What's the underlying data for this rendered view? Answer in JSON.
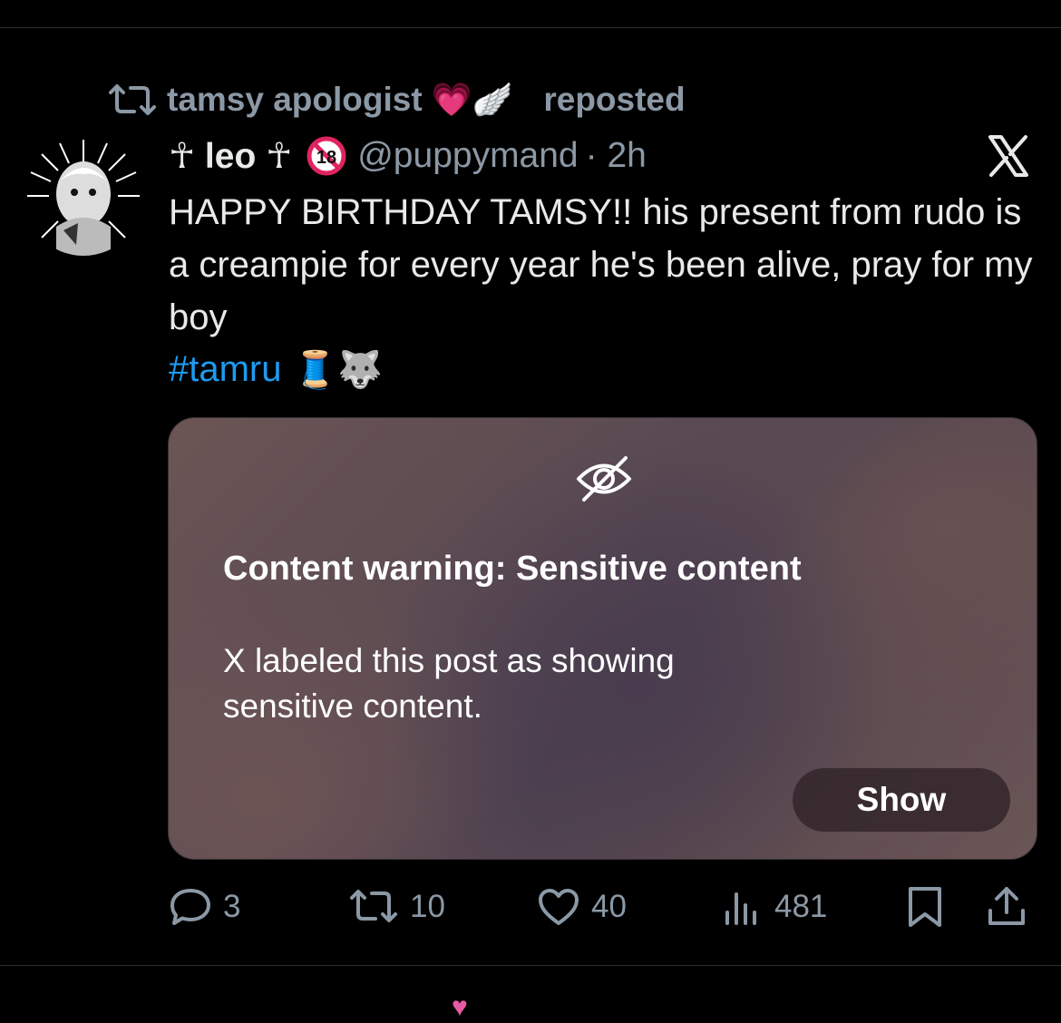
{
  "repost": {
    "reposter_name": "tamsy apologist",
    "emoji": "💗🪽",
    "verb": "reposted"
  },
  "post": {
    "display_name": "☥ leo ☥",
    "badge_text": "18",
    "handle": "@puppymand",
    "time": "· 2h",
    "text": "HAPPY BIRTHDAY TAMSY!! his present from rudo is a creampie for every year he's been alive, pray for my boy",
    "hashtag": "#tamru",
    "hashtag_emoji": "🧵🐺"
  },
  "content_warning": {
    "title": "Content warning: Sensitive content",
    "body": "X labeled this post as showing sensitive content.",
    "show_label": "Show"
  },
  "actions": {
    "replies": "3",
    "reposts": "10",
    "likes": "40",
    "views": "481"
  },
  "icons": {
    "repost": "repost-icon",
    "reply": "reply-icon",
    "like": "heart-icon",
    "views": "views-icon",
    "bookmark": "bookmark-icon",
    "share": "share-icon",
    "platform": "x-logo-icon",
    "sensitive": "eye-off-icon"
  },
  "colors": {
    "background": "#000000",
    "muted": "#8b98a5",
    "hashtag": "#1d9bf0",
    "text": "#e7e9ea"
  }
}
